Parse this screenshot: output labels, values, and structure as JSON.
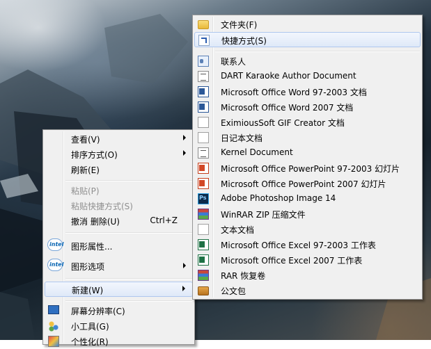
{
  "left_menu": {
    "items": [
      {
        "label": "查看(V)",
        "submenu": true
      },
      {
        "label": "排序方式(O)",
        "submenu": true
      },
      {
        "label": "刷新(E)"
      },
      {
        "label": "粘贴(P)",
        "disabled": true
      },
      {
        "label": "粘贴快捷方式(S)",
        "disabled": true
      },
      {
        "label": "撤消 删除(U)",
        "shortcut": "Ctrl+Z"
      },
      {
        "label": "图形属性...",
        "icon": "intel-icon"
      },
      {
        "label": "图形选项",
        "icon": "intel-icon",
        "submenu": true
      },
      {
        "label": "新建(W)",
        "submenu": true,
        "highlighted": true
      },
      {
        "label": "屏幕分辨率(C)",
        "icon": "monitor-icon"
      },
      {
        "label": "小工具(G)",
        "icon": "gadget-icon"
      },
      {
        "label": "个性化(R)",
        "icon": "personalize-icon"
      }
    ]
  },
  "new_submenu": {
    "items": [
      {
        "label": "文件夹(F)",
        "icon": "folder-icon"
      },
      {
        "label": "快捷方式(S)",
        "icon": "shortcut-icon",
        "highlighted": true
      },
      {
        "label": "联系人",
        "icon": "contact-icon"
      },
      {
        "label": "DART Karaoke Author Document",
        "icon": "document-icon"
      },
      {
        "label": "Microsoft Office Word 97-2003 文档",
        "icon": "word-icon"
      },
      {
        "label": "Microsoft Office Word 2007 文档",
        "icon": "word-icon"
      },
      {
        "label": "EximiousSoft GIF Creator 文档",
        "icon": "gif-document-icon"
      },
      {
        "label": "日记本文档",
        "icon": "journal-icon"
      },
      {
        "label": "Kernel Document",
        "icon": "document-icon"
      },
      {
        "label": "Microsoft Office PowerPoint 97-2003 幻灯片",
        "icon": "powerpoint-icon"
      },
      {
        "label": "Microsoft Office PowerPoint 2007 幻灯片",
        "icon": "powerpoint-icon"
      },
      {
        "label": "Adobe Photoshop Image 14",
        "icon": "photoshop-icon"
      },
      {
        "label": "WinRAR ZIP 压缩文件",
        "icon": "winrar-icon"
      },
      {
        "label": "文本文档",
        "icon": "text-document-icon"
      },
      {
        "label": "Microsoft Office Excel 97-2003 工作表",
        "icon": "excel-icon"
      },
      {
        "label": "Microsoft Office Excel 2007 工作表",
        "icon": "excel-icon"
      },
      {
        "label": "RAR 恢复卷",
        "icon": "winrar-icon"
      },
      {
        "label": "公文包",
        "icon": "briefcase-icon"
      }
    ]
  }
}
